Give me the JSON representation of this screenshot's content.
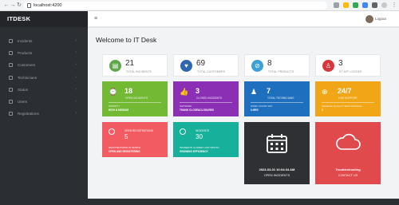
{
  "browser": {
    "url": "localhost:4200"
  },
  "sidebar": {
    "brand": "ITDESK",
    "items": [
      {
        "label": "Incidents"
      },
      {
        "label": "Products"
      },
      {
        "label": "Customers"
      },
      {
        "label": "Technicians"
      },
      {
        "label": "Status"
      },
      {
        "label": "Users"
      },
      {
        "label": "Registrations"
      }
    ]
  },
  "header": {
    "user_name": "Logout"
  },
  "main": {
    "title": "Welcome to IT Desk",
    "stats": [
      {
        "value": "21",
        "label": "TOTAL INCIDENTS",
        "color": "#5fa84a"
      },
      {
        "value": "69",
        "label": "TOTAL CUSTOMERS",
        "color": "#2d67b0"
      },
      {
        "value": "8",
        "label": "TOTAL PRODUCTS",
        "color": "#3ca0d8"
      },
      {
        "value": "3",
        "label": "ST AFF LOGGED",
        "color": "#d7373c"
      }
    ],
    "tiles": [
      {
        "value": "18",
        "label": "OPEN INCIDENTS",
        "sub": "PRIORITY",
        "val": "HIGH & MEDIUM",
        "color": "#73b934"
      },
      {
        "value": "3",
        "label": "CLOSED INCIDENTS",
        "sub": "SATISFIED",
        "val": "THANK CLOSE&CLOSURES",
        "color": "#8b2fb5"
      },
      {
        "value": "7",
        "label": "TOTAL TECHNICIANS",
        "sub": "WORK COUNT DAY",
        "val": "0-HRS",
        "color": "#1f6fbf"
      },
      {
        "value": "24/7",
        "label": "LIVE SUPPORT",
        "sub": "GENERAL QUALITY MAINTENANCE",
        "val": "2",
        "color": "#f0a616"
      }
    ],
    "tiles2": [
      {
        "header": "OPEN REGISTRATIONS",
        "value": "5",
        "line1": "REGISTRATIONS IN MONTH",
        "line2": "OPEN AND REGISTERING",
        "color": "#f15b61"
      },
      {
        "header": "INCIDENTS",
        "value": "30",
        "line1": "INCIDENTS CLOSED LAST MONTH",
        "line2": "GROWING EFFICIENCY",
        "color": "#16b09b"
      }
    ],
    "datetime_tile": {
      "datetime": "2023-03-01 10:04:34 AM",
      "caption": "OPEN INCIDENTS",
      "color": "#2f3033"
    },
    "trouble_tile": {
      "title": "Troubleshooting",
      "caption": "CONTACT US",
      "color": "#e04a4c"
    }
  }
}
